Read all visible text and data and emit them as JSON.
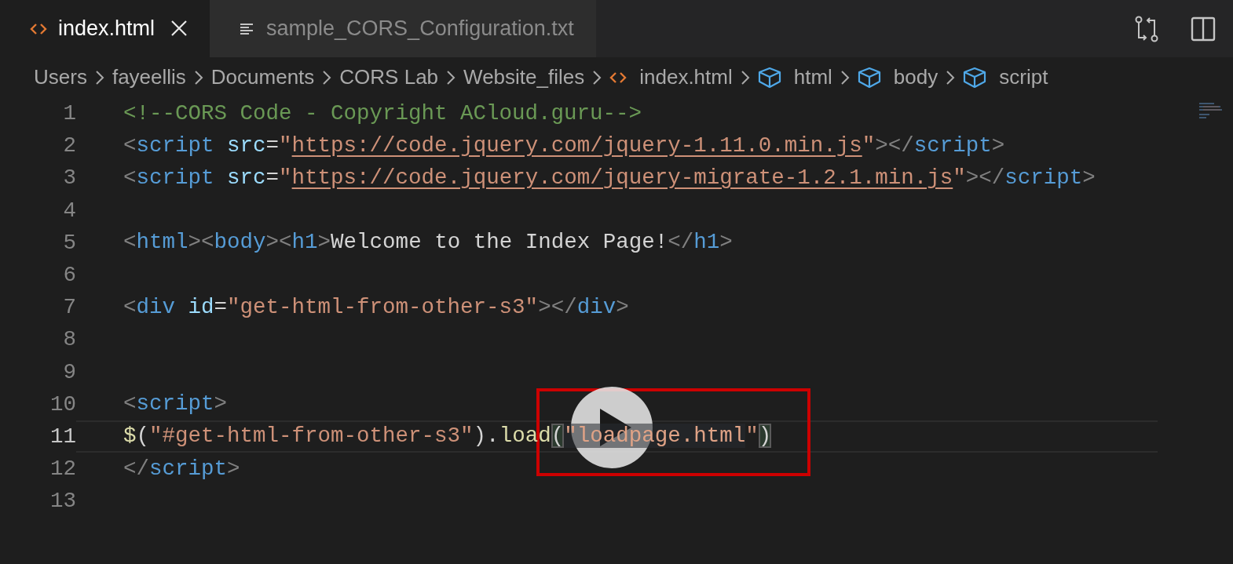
{
  "tabs": [
    {
      "label": "index.html",
      "kind": "html",
      "selected": true,
      "closable": true
    },
    {
      "label": "sample_CORS_Configuration.txt",
      "kind": "text",
      "selected": false,
      "closable": false
    }
  ],
  "breadcrumbs": [
    {
      "label": "Users",
      "kind": "folder"
    },
    {
      "label": "fayeellis",
      "kind": "folder"
    },
    {
      "label": "Documents",
      "kind": "folder"
    },
    {
      "label": "CORS Lab",
      "kind": "folder"
    },
    {
      "label": "Website_files",
      "kind": "folder"
    },
    {
      "label": "index.html",
      "kind": "html"
    },
    {
      "label": "html",
      "kind": "symbol"
    },
    {
      "label": "body",
      "kind": "symbol"
    },
    {
      "label": "script",
      "kind": "symbol"
    }
  ],
  "editor": {
    "lines": [
      {
        "number": "1",
        "current": false,
        "tokens": [
          {
            "kind": "comment",
            "text": "<!--CORS Code - Copyright ACloud.guru-->"
          }
        ]
      },
      {
        "number": "2",
        "current": false,
        "tokens": [
          {
            "kind": "punct",
            "text": "<"
          },
          {
            "kind": "tag",
            "text": "script"
          },
          {
            "kind": "attr",
            "text": " src"
          },
          {
            "kind": "text",
            "text": "="
          },
          {
            "kind": "string",
            "text": "\""
          },
          {
            "kind": "link",
            "text": "https://code.jquery.com/jquery-1.11.0.min.js"
          },
          {
            "kind": "string",
            "text": "\""
          },
          {
            "kind": "punct",
            "text": "></"
          },
          {
            "kind": "tag",
            "text": "script"
          },
          {
            "kind": "punct",
            "text": ">"
          }
        ]
      },
      {
        "number": "3",
        "current": false,
        "tokens": [
          {
            "kind": "punct",
            "text": "<"
          },
          {
            "kind": "tag",
            "text": "script"
          },
          {
            "kind": "attr",
            "text": " src"
          },
          {
            "kind": "text",
            "text": "="
          },
          {
            "kind": "string",
            "text": "\""
          },
          {
            "kind": "link",
            "text": "https://code.jquery.com/jquery-migrate-1.2.1.min.js"
          },
          {
            "kind": "string",
            "text": "\""
          },
          {
            "kind": "punct",
            "text": "></"
          },
          {
            "kind": "tag",
            "text": "script"
          },
          {
            "kind": "punct",
            "text": ">"
          }
        ]
      },
      {
        "number": "4",
        "current": false
      },
      {
        "number": "5",
        "current": false,
        "tokens": [
          {
            "kind": "punct",
            "text": "<"
          },
          {
            "kind": "tag",
            "text": "html"
          },
          {
            "kind": "punct",
            "text": "><"
          },
          {
            "kind": "tag",
            "text": "body"
          },
          {
            "kind": "punct",
            "text": "><"
          },
          {
            "kind": "tag",
            "text": "h1"
          },
          {
            "kind": "punct",
            "text": ">"
          },
          {
            "kind": "text",
            "text": "Welcome to the Index Page!"
          },
          {
            "kind": "punct",
            "text": "</"
          },
          {
            "kind": "tag",
            "text": "h1"
          },
          {
            "kind": "punct",
            "text": ">"
          }
        ]
      },
      {
        "number": "6",
        "current": false
      },
      {
        "number": "7",
        "current": false,
        "tokens": [
          {
            "kind": "punct",
            "text": "<"
          },
          {
            "kind": "tag",
            "text": "div"
          },
          {
            "kind": "attr",
            "text": " id"
          },
          {
            "kind": "text",
            "text": "="
          },
          {
            "kind": "string",
            "text": "\"get-html-from-other-s3\""
          },
          {
            "kind": "punct",
            "text": "></"
          },
          {
            "kind": "tag",
            "text": "div"
          },
          {
            "kind": "punct",
            "text": ">"
          }
        ]
      },
      {
        "number": "8",
        "current": false
      },
      {
        "number": "9",
        "current": false
      },
      {
        "number": "10",
        "current": false,
        "tokens": [
          {
            "kind": "punct",
            "text": "<"
          },
          {
            "kind": "tag",
            "text": "script"
          },
          {
            "kind": "punct",
            "text": ">"
          }
        ]
      },
      {
        "number": "11",
        "current": true,
        "tokens": [
          {
            "kind": "func",
            "text": "$"
          },
          {
            "kind": "text",
            "text": "("
          },
          {
            "kind": "string",
            "text": "\"#get-html-from-other-s3\""
          },
          {
            "kind": "text",
            "text": ")."
          },
          {
            "kind": "func",
            "text": "load"
          },
          {
            "kind": "bracket-match",
            "text": "("
          },
          {
            "kind": "selected-string",
            "text": "\"loadpage.html"
          },
          {
            "kind": "string",
            "text": "\""
          },
          {
            "kind": "bracket-match",
            "text": ")"
          }
        ]
      },
      {
        "number": "12",
        "current": false,
        "tokens": [
          {
            "kind": "punct",
            "text": "</"
          },
          {
            "kind": "tag",
            "text": "script"
          },
          {
            "kind": "punct",
            "text": ">"
          }
        ]
      },
      {
        "number": "13",
        "current": false
      }
    ]
  }
}
